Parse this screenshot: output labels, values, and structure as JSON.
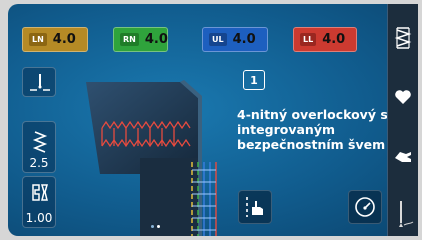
{
  "tension": [
    {
      "code": "LN",
      "value": "4.0"
    },
    {
      "code": "RN",
      "value": "4.0"
    },
    {
      "code": "UL",
      "value": "4.0"
    },
    {
      "code": "LL",
      "value": "4.0"
    }
  ],
  "left_panel": {
    "stitch_length": "2.5",
    "differential_feed": "1.00"
  },
  "stitch": {
    "number": "1",
    "description": "4-nitný overlockový s integrovaným bezpečnostním švem"
  },
  "pagination": {
    "total": 2,
    "current": 1
  },
  "icons": {
    "needle": "needle-position-icon",
    "stitch_length": "stitch-length-icon",
    "diff_feed": "differential-feed-icon",
    "hand": "hand-guide-icon",
    "speed": "speedometer-icon",
    "side_top": "overlock-stitch-icon",
    "side_mid": "heart-icon",
    "side_bot": "hand-icon",
    "side_needle": "needle-icon"
  },
  "colors": {
    "ln": "#b58a25",
    "rn": "#2fa33c",
    "ul": "#1d5fbf",
    "ll": "#cc3a30",
    "screen": "#115d8f"
  }
}
